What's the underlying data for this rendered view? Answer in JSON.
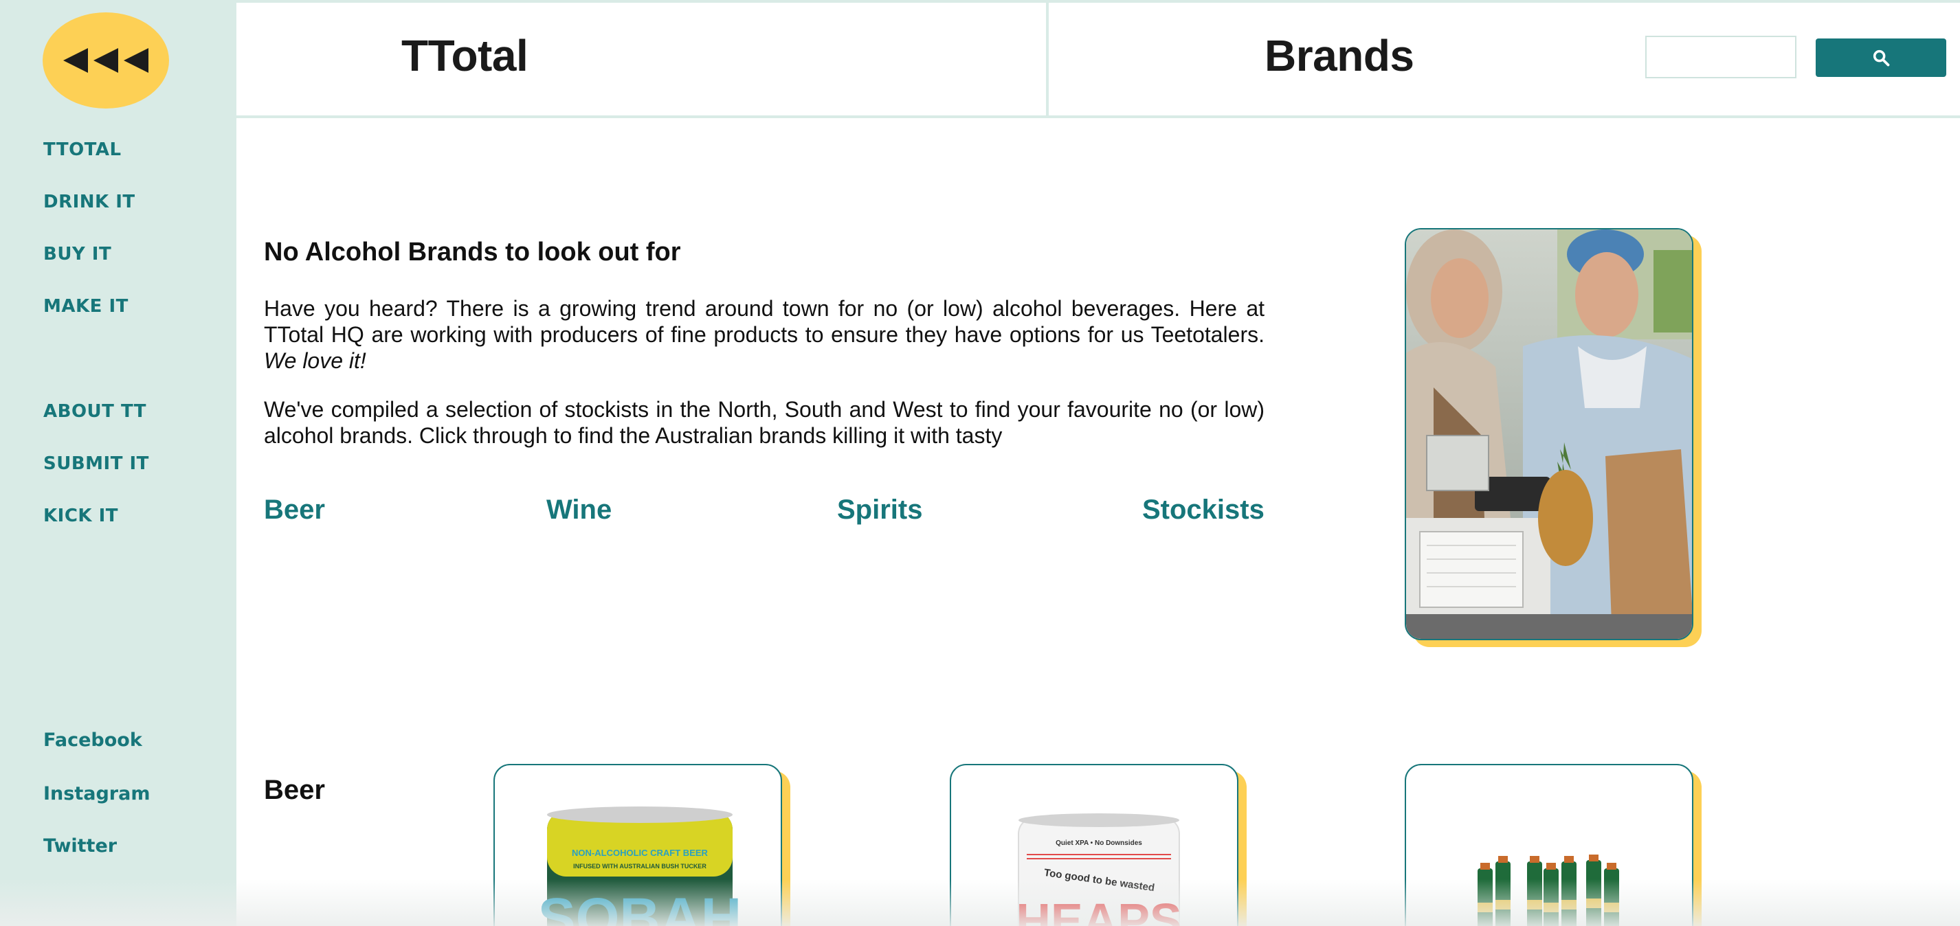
{
  "sidebar": {
    "logo_icon": "rewind-arrows-icon",
    "nav": [
      {
        "label": "TTOTAL"
      },
      {
        "label": "DRINK IT"
      },
      {
        "label": "BUY IT"
      },
      {
        "label": "MAKE IT"
      },
      {
        "label": "ABOUT TT"
      },
      {
        "label": "SUBMIT IT"
      },
      {
        "label": "KICK IT"
      }
    ],
    "social": [
      {
        "label": "Facebook"
      },
      {
        "label": "Instagram"
      },
      {
        "label": "Twitter"
      }
    ]
  },
  "header": {
    "site_title": "TTotal",
    "page_title": "Brands",
    "search": {
      "placeholder": "",
      "value": "",
      "button_icon": "search-icon"
    }
  },
  "intro": {
    "heading": "No Alcohol Brands to look out for",
    "p1_text": "Have you heard? There is a growing trend around town for no (or low) alcohol beverages. Here at TTotal HQ are working with producers of fine products to ensure they have options for us Teetotalers.",
    "p1_emphasis": "We love it!",
    "p2_text": "We've compiled a selection of stockists in the North, South and West to find your favourite no (or low) alcohol brands. Click through to find the Australian brands killing it with tasty",
    "categories": [
      {
        "label": "Beer"
      },
      {
        "label": "Wine"
      },
      {
        "label": "Spirits"
      },
      {
        "label": "Stockists"
      }
    ]
  },
  "section": {
    "title": "Beer",
    "products": [
      {
        "can_top_text": "NON-ALCOHOLIC CRAFT BEER",
        "can_sub_text": "INFUSED WITH AUSTRALIAN BUSH TUCKER",
        "brand_text": "SOBAH"
      },
      {
        "can_top_text": "Quiet XPA • No Downsides",
        "can_sub_text": "Too good to be wasted",
        "brand_text": "HEAPS"
      },
      {
        "can_top_text": "",
        "can_sub_text": "",
        "brand_text": ""
      }
    ]
  },
  "colors": {
    "sidebar_bg": "#d9ebe6",
    "accent": "#17767a",
    "highlight": "#fdd055"
  }
}
